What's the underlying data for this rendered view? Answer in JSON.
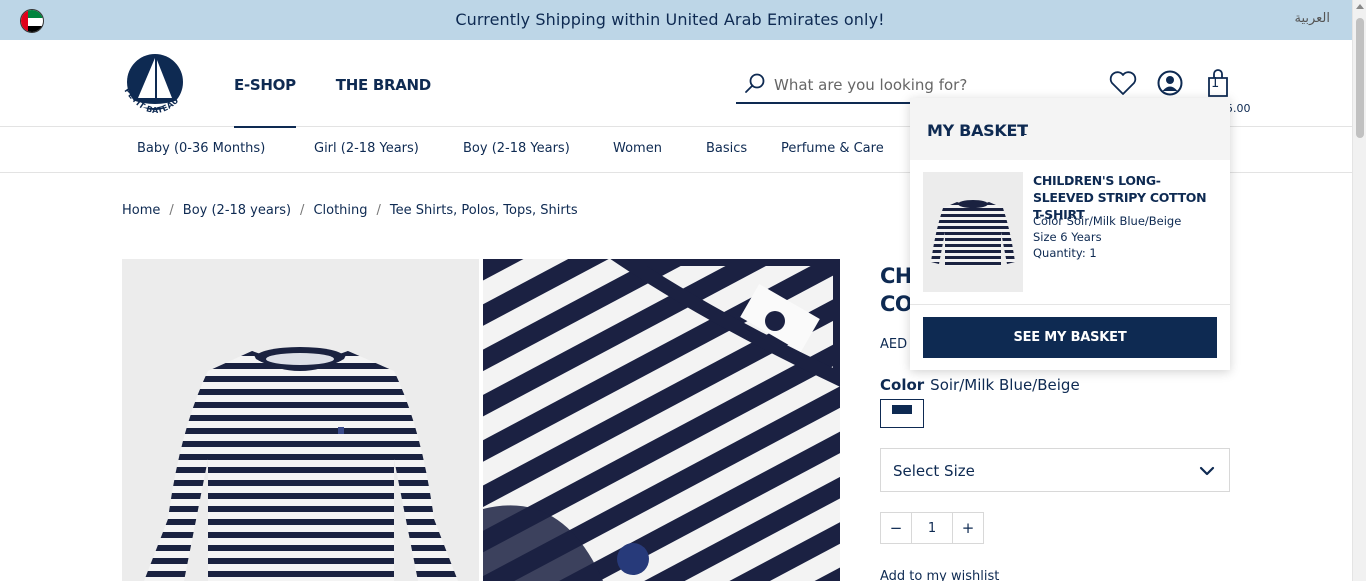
{
  "banner": {
    "text": "Currently Shipping within United Arab Emirates only!",
    "language": "العربية"
  },
  "header": {
    "logo_text": "PETIT BATEAU",
    "nav": [
      "E-SHOP",
      "THE BRAND"
    ],
    "search_placeholder": "What are you looking for?",
    "basket_count": "1",
    "basket_total_partial": "5.00"
  },
  "categories": [
    "Baby (0-36 Months)",
    "Girl (2-18 Years)",
    "Boy (2-18 Years)",
    "Women",
    "Basics",
    "Perfume & Care"
  ],
  "breadcrumb": [
    "Home",
    "Boy (2-18 years)",
    "Clothing",
    "Tee Shirts, Polos, Tops, Shirts"
  ],
  "product": {
    "title_line1": "CHI",
    "title_line2": "COT",
    "price_prefix": "AED",
    "color_label": "Color",
    "color_value": "Soir/Milk Blue/Beige",
    "size_placeholder": "Select Size",
    "quantity": "1",
    "qty_minus": "−",
    "qty_plus": "+",
    "wishlist_partial": "Add to my wishlist"
  },
  "basket": {
    "title": "MY BASKET",
    "count": "1",
    "item_title": "CHILDREN'S LONG-SLEEVED STRIPY COTTON T-SHIRT",
    "item_color": "Color Soir/Milk Blue/Beige",
    "item_size": "Size 6 Years",
    "item_quantity": "Quantity: 1",
    "button": "SEE MY BASKET"
  },
  "colors": {
    "navy": "#0e2a52",
    "banner_bg": "#bdd6e7"
  }
}
